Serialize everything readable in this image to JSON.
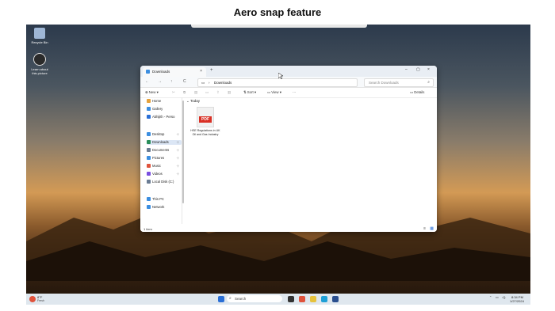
{
  "caption": "Aero snap feature",
  "desktop": {
    "icons": [
      {
        "label": "Recycle Bin",
        "icon": "recycle-bin-icon"
      },
      {
        "label": "Learn about this picture",
        "icon": "learn-icon"
      }
    ]
  },
  "explorer": {
    "tab_title": "Downloads",
    "tab_close": "×",
    "new_tab": "+",
    "window_controls": [
      "–",
      "▢",
      "×"
    ],
    "nav_buttons": [
      "←",
      "→",
      "↑",
      "C"
    ],
    "path": [
      "Downloads"
    ],
    "search_placeholder": "Search Downloads",
    "toolbar": {
      "new_label": "New",
      "sort_label": "Sort",
      "view_label": "View",
      "more_label": "···",
      "details_label": "Details"
    },
    "nav_pane": [
      {
        "label": "Home",
        "color": "#e6a23c",
        "pinned": false
      },
      {
        "label": "Gallery",
        "color": "#3c8ee0",
        "pinned": false
      },
      {
        "label": "Abhijith - Perso",
        "color": "#2a6fd6",
        "pinned": false
      },
      {
        "label": "Desktop",
        "color": "#3c8ee0",
        "pinned": true
      },
      {
        "label": "Downloads",
        "color": "#2a8f5a",
        "pinned": true
      },
      {
        "label": "Documents",
        "color": "#6b7c93",
        "pinned": true
      },
      {
        "label": "Pictures",
        "color": "#3c8ee0",
        "pinned": true
      },
      {
        "label": "Music",
        "color": "#e0533c",
        "pinned": true
      },
      {
        "label": "Videos",
        "color": "#7a4fe0",
        "pinned": true
      },
      {
        "label": "Local Disk (C:)",
        "color": "#6b7c93",
        "pinned": false
      },
      {
        "label": "This PC",
        "color": "#3c8ee0",
        "pinned": false
      },
      {
        "label": "Network",
        "color": "#3c8ee0",
        "pinned": false
      }
    ],
    "group_label": "Today",
    "files": [
      {
        "name": "HSE Regulations in UK Oil and Gas Industry",
        "type_badge": "PDF"
      }
    ],
    "status": "1 item"
  },
  "taskbar": {
    "weather_temp": "8°F",
    "weather_desc": "Fresh",
    "search_placeholder": "Search",
    "time": "8:34 PM",
    "date": "1/27/2024"
  }
}
